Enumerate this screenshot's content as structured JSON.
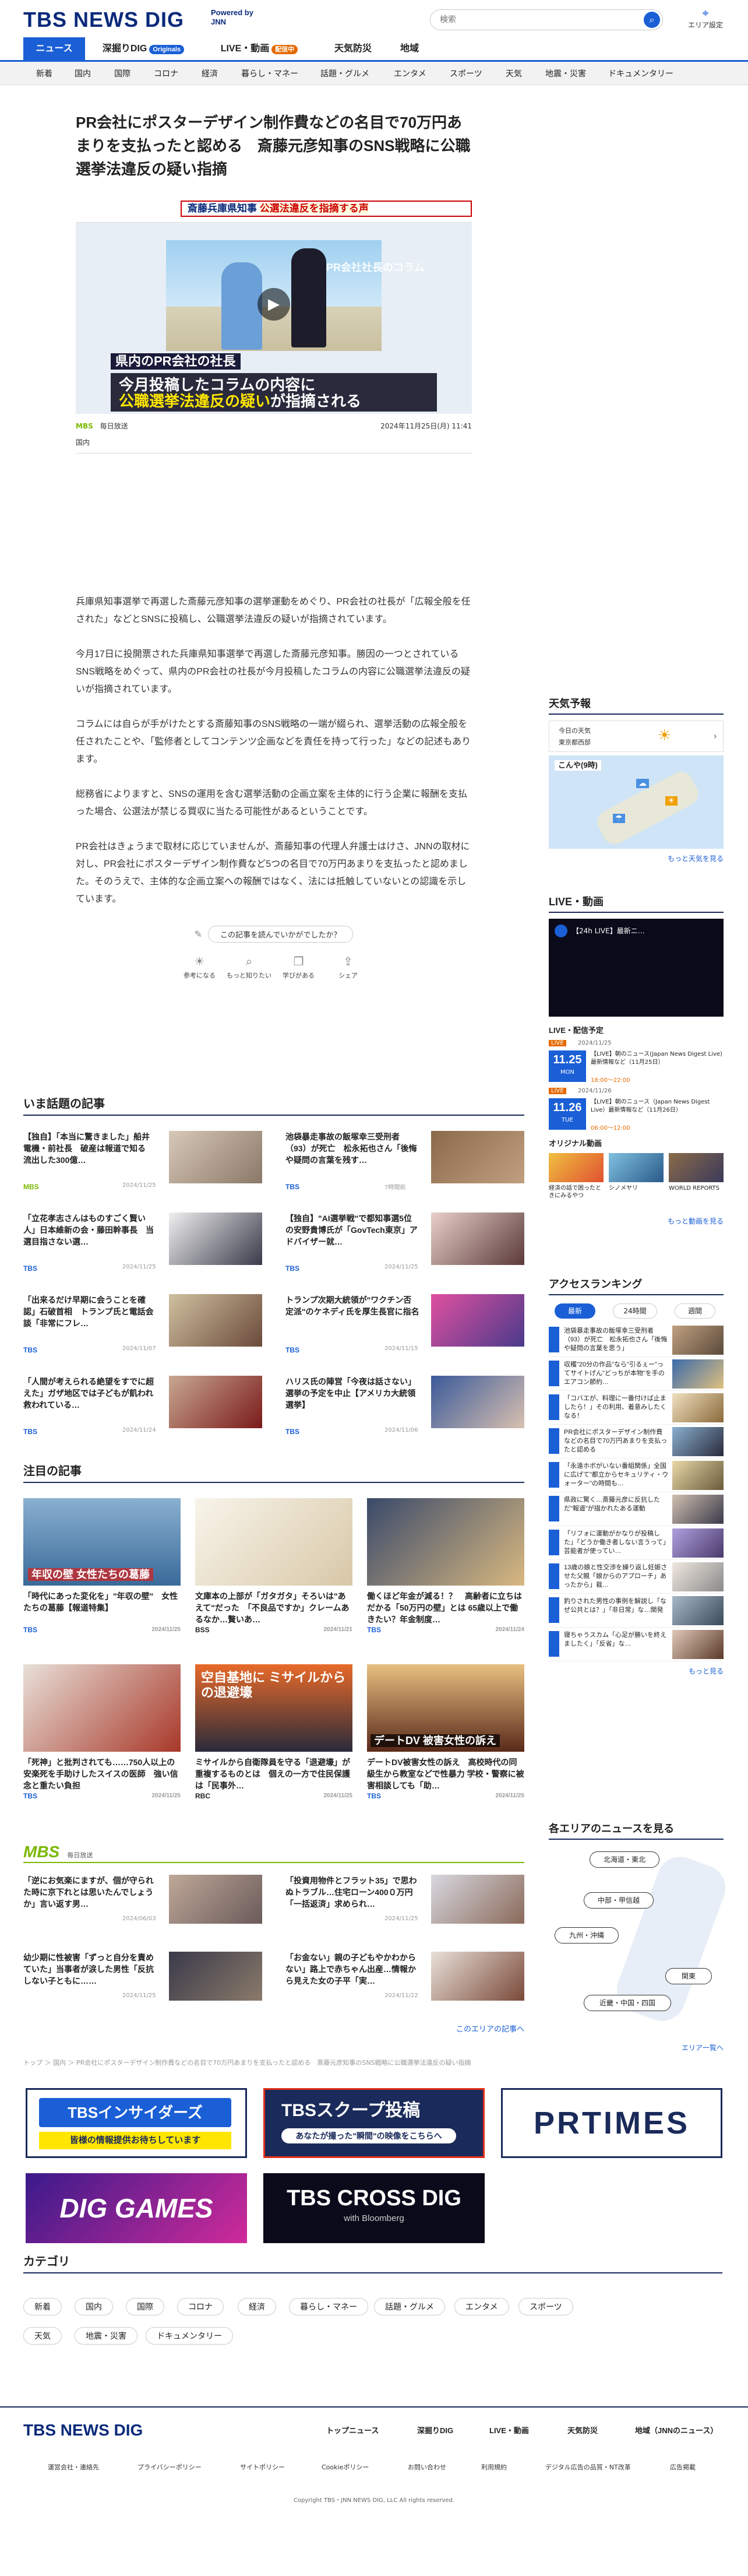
{
  "header": {
    "logo": "TBS NEWS DIG",
    "powered": "Powered by JNN",
    "search_placeholder": "検索",
    "area_label": "エリア設定"
  },
  "nav1": [
    {
      "label": "ニュース"
    },
    {
      "label": "深掘りDIG",
      "badge": "Originals"
    },
    {
      "label": "LIVE・動画",
      "badge": "配信中"
    },
    {
      "label": "天気防災"
    },
    {
      "label": "地域"
    }
  ],
  "nav2": [
    "新着",
    "国内",
    "国際",
    "コロナ",
    "経済",
    "暮らし・マネー",
    "話題・グルメ",
    "エンタメ",
    "スポーツ",
    "天気",
    "地震・災害",
    "ドキュメンタリー"
  ],
  "article": {
    "title": "PR会社にポスターデザイン制作費などの名目で70万円あまりを支払ったと認める　斎藤元彦知事のSNS戦略に公職選挙法違反の疑い指摘",
    "video": {
      "topbar_a": "斎藤兵庫県知事",
      "topbar_b": "公選法違反を指摘する声",
      "watermark": "PR会社社長のコラム",
      "caption1": "県内のPR会社の社長",
      "caption2a": "今月投稿したコラムの内容に",
      "caption2b": "公職選挙法違反の疑い",
      "caption2c": "が指摘される"
    },
    "source_mark": "MBS",
    "source": "毎日放送",
    "date": "2024年11月25日(月) 11:41",
    "category": "国内",
    "paragraphs": [
      "兵庫県知事選挙で再選した斎藤元彦知事の選挙運動をめぐり、PR会社の社長が「広報全般を任された」などとSNSに投稿し、公職選挙法違反の疑いが指摘されています。",
      "今月17日に投開票された兵庫県知事選挙で再選した斎藤元彦知事。勝因の一つとされているSNS戦略をめぐって、県内のPR会社の社長が今月投稿したコラムの内容に公職選挙法違反の疑いが指摘されています。",
      "コラムには自らが手がけたとする斎藤知事のSNS戦略の一端が綴られ、選挙活動の広報全般を任されたことや、「監修者としてコンテンツ企画などを責任を持って行った」などの記述もあります。",
      "総務省によりますと、SNSの運用を含む選挙活動の企画立案を主体的に行う企業に報酬を支払った場合、公選法が禁じる買収に当たる可能性があるということです。",
      "PR会社はきょうまで取材に応じていませんが、斎藤知事の代理人弁護士はけさ、JNNの取材に対し、PR会社にポスターデザイン制作費など5つの名目で70万円あまりを支払ったと認めました。そのうえで、主体的な企画立案への報酬ではなく、法には抵触していないとの認識を示しています。"
    ],
    "feedback_q": "この記事を読んでいかがでしたか？",
    "reactions": [
      "参考になる",
      "もっと知りたい",
      "学びがある",
      "シェア"
    ]
  },
  "trending": {
    "title": "いま話題の記事",
    "items": [
      {
        "title": "【独自】「本当に驚きました」船井電機・前社長　破産は報道で知る　流出した300億…",
        "src": "MBS",
        "date": "2024/11/25"
      },
      {
        "title": "池袋暴走事故の飯塚幸三受刑者（93）が死亡　松永拓也さん「後悔や疑問の言葉を残す…",
        "src": "TBS",
        "date": "7時間前"
      },
      {
        "title": "「立花孝志さんはものすごく賢い人」日本維新の会・藤田幹事長　当選目指さない選…",
        "src": "TBS",
        "date": "2024/11/25"
      },
      {
        "title": "【独自】\"AI選挙戦\"で都知事選5位の安野貴博氏が「GovTech東京」アドバイザー就…",
        "src": "TBS",
        "date": "2024/11/25"
      },
      {
        "title": "「出来るだけ早期に会うことを確認」石破首相　トランプ氏と電話会談「非常にフレ…",
        "src": "TBS",
        "date": "2024/11/07"
      },
      {
        "title": "トランプ次期大統領が\"ワクチン否定派\"のケネディ氏を厚生長官に指名",
        "src": "TBS",
        "date": "2024/11/15"
      },
      {
        "title": "「人間が考えられる絶望をすでに超えた」ガザ地区では子どもが飢われ救われている…",
        "src": "TBS",
        "date": "2024/11/24"
      },
      {
        "title": "ハリス氏の陣営「今夜は話さない」　選挙の予定を中止【アメリカ大統領選挙】",
        "src": "TBS",
        "date": "2024/11/06"
      }
    ]
  },
  "featured": {
    "title": "注目の記事",
    "items": [
      {
        "title": "「時代にあった変化を」\"年収の壁\"　女性たちの葛藤【報道特集】",
        "src": "TBS",
        "date": "2024/11/25",
        "img_text": "年収の壁 女性たちの葛藤"
      },
      {
        "title": "文庫本の上部が「ガタガタ」そろいは\"あえて\"だった　「不良品ですか」クレームあるなか…贅いあ…",
        "src": "BSS",
        "date": "2024/11/21",
        "img_text": ""
      },
      {
        "title": "働くほど年金が減る！？　高齢者に立ちはだかる「50万円の壁」とは 65歳以上で働きたい？年金制度…",
        "src": "TBS",
        "date": "2024/11/24",
        "img_text": ""
      },
      {
        "title": "「死神」と批判されても……750人以上の安楽死を手助けしたスイスの医師　強い信念と重たい負担",
        "src": "TBS",
        "date": "2024/11/25",
        "img_text": ""
      },
      {
        "title": "ミサイルから自衛隊員を守る「退避壕」が重複するものとは　個えの一方で住民保護は「民事外…",
        "src": "RBC",
        "date": "2024/11/25",
        "img_text": "空自基地に ミサイルからの退避壕"
      },
      {
        "title": "デートDV被害女性の訴え　高校時代の同級生から教室などで性暴力 学校・警察に被害相談しても「助…",
        "src": "TBS",
        "date": "2024/11/25",
        "img_text": "デートDV 被害女性の訴え"
      }
    ]
  },
  "mbs": {
    "logo": "MBS",
    "label": "毎日放送",
    "items": [
      {
        "title": "「逆にお気楽にますが、個が守られた時に京下れとは思いたんでしょうか」言い返す男…",
        "date": "2024/06/03"
      },
      {
        "title": "「投資用物件とフラット35」で思わぬトラブル…住宅ローン400０万円「一括返済」求められ…",
        "date": "2024/11/25"
      },
      {
        "title": "幼少期に性被害「ずっと自分を責めていた」当事者が涙した男性「反抗しない子ともに……",
        "date": "2024/11/25"
      },
      {
        "title": "「お金ない」親の子どもやかわからない」路上で赤ちゃん出産…情報から見えた女の子平「実…",
        "date": "2024/11/22"
      }
    ],
    "more": "このエリアの記事へ"
  },
  "breadcrumb": "トップ ＞ 国内 ＞ PR会社にポスターデザイン制作費などの名目で70万円あまりを支払ったと認める　斎藤元彦知事のSNS戦略に公職選挙法違反の疑い指摘",
  "banners": {
    "insiders": "TBSインサイダーズ",
    "insiders_sub": "皆様の情報提供お待ちしています",
    "scoop": "TBSスクープ投稿",
    "scoop_sub": "あなたが撮った\"瞬間\"の映像をこちらへ",
    "prtimes": "PRTIMES",
    "diggames": "DIG GAMES",
    "crossdig": "TBS CROSS DIG",
    "crossdig_sub": "with Bloomberg"
  },
  "categories": {
    "title": "カテゴリ",
    "items": [
      "新着",
      "国内",
      "国際",
      "コロナ",
      "経済",
      "暮らし・マネー",
      "話題・グルメ",
      "エンタメ",
      "スポーツ",
      "天気",
      "地震・災害",
      "ドキュメンタリー"
    ]
  },
  "side": {
    "weather": {
      "title": "天気予報",
      "today": "今日の天気",
      "place": "東京都西部",
      "map_label": "こんや(9時)",
      "more": "もっと天気を見る"
    },
    "live": {
      "title": "LIVE・動画",
      "video_label": "【24h LIVE】最新ニ…",
      "sched_title": "LIVE・配信予定",
      "sched": [
        {
          "day": "11.25",
          "dow": "MON",
          "tag": "LIVE",
          "date": "2024/11/25",
          "title": "【LIVE】朝のニュース(Japan News Digest Live) 最新情報など（11月25日）",
          "time": "18:00〜22:00"
        },
        {
          "day": "11.26",
          "dow": "TUE",
          "tag": "LIVE",
          "date": "2024/11/26",
          "title": "【LIVE】朝のニュース（Japan News Digest Live）最新情報など（11月26日）",
          "time": "06:00〜12:00"
        }
      ],
      "orig_title": "オリジナル動画",
      "orig": [
        "経済の話で困ったときにみるやつ",
        "シノメヤリ",
        "WORLD REPORTS"
      ],
      "more": "もっと動画を見る"
    },
    "ranking": {
      "title": "アクセスランキング",
      "tabs": [
        "最新",
        "24時間",
        "週間"
      ],
      "items": [
        "池袋暴走事故の飯塚幸三受刑者（93）が死亡　松永拓也さん「後悔や疑問の言葉を思う」",
        "収穫\"20分の作品\"なら\"引るぇー\"ってサイトげん\"どっちが本物\"を手のエアコン節約…",
        "「コバエが、料理に一番付けば止ましたら！」その利用、着意みしたくなる！",
        "PR会社にポスターデザイン制作費などの名目で70万円あまりを支払ったと認める",
        "「永遠ホボがいない番組関係」全国に広げて\"都立からセキュリティ・ウォーター\"の時間も…",
        "県政に驚く…斎藤元彦に反抗しただ\"報道\"が描かれたある運動",
        "「リフォに運動がかなりが投稿した」「どうか働き者しない言うって」芸能者が使ってい…",
        "13歳の娘と性交渉を繰り返し妊娠させた父親「娘からのアプローチ」あったから」裁…",
        "釣りされた男性の事例を解説し「なぜ公共とは？」「非日常」な…関発",
        "寝ちゃうスカム「心足が勝いを終えましたく」「反省」な…"
      ],
      "more": "もっと見る"
    },
    "area": {
      "title": "各エリアのニュースを見る",
      "regions": [
        "北海道・東北",
        "中部・甲信越",
        "九州・沖縄",
        "関東",
        "近畿・中国・四国"
      ],
      "more": "エリア一覧へ"
    }
  },
  "footer": {
    "logo": "TBS NEWS DIG",
    "links": [
      "トップニュース",
      "深掘りDIG",
      "LIVE・動画",
      "天気防災",
      "地域（JNNのニュース）"
    ],
    "sub": [
      "運営会社・連絡先",
      "プライバシーポリシー",
      "サイトポリシー",
      "Cookieポリシー",
      "お問い合わせ",
      "利用規約",
      "デジタル広告の品質・NT改革",
      "広告掲載"
    ],
    "copyright": "Copyright TBS・JNN NEWS DIG, LLC All rights reserved."
  }
}
